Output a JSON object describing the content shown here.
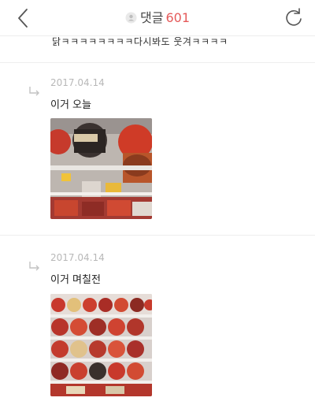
{
  "header": {
    "back_icon": "chevron-left-icon",
    "title_icon": "comment-user-icon",
    "title": "댓글",
    "count": "601",
    "refresh_icon": "refresh-icon"
  },
  "previous_comment": {
    "text": "닭ㅋㅋㅋㅋㅋㅋㅋㅋ다시봐도 웃겨ㅋㅋㅋㅋ"
  },
  "replies": [
    {
      "date": "2017.04.14",
      "text": "이거 오늘",
      "photo": "store-shelf-with-few-noodle-cups-photo"
    },
    {
      "date": "2017.04.14",
      "text": "이거 며칠전",
      "photo": "store-shelf-fully-stocked-noodle-cups-photo"
    }
  ],
  "colors": {
    "accent": "#e55a5a",
    "date_gray": "#b8b8b8",
    "divider": "#eeeeee"
  }
}
